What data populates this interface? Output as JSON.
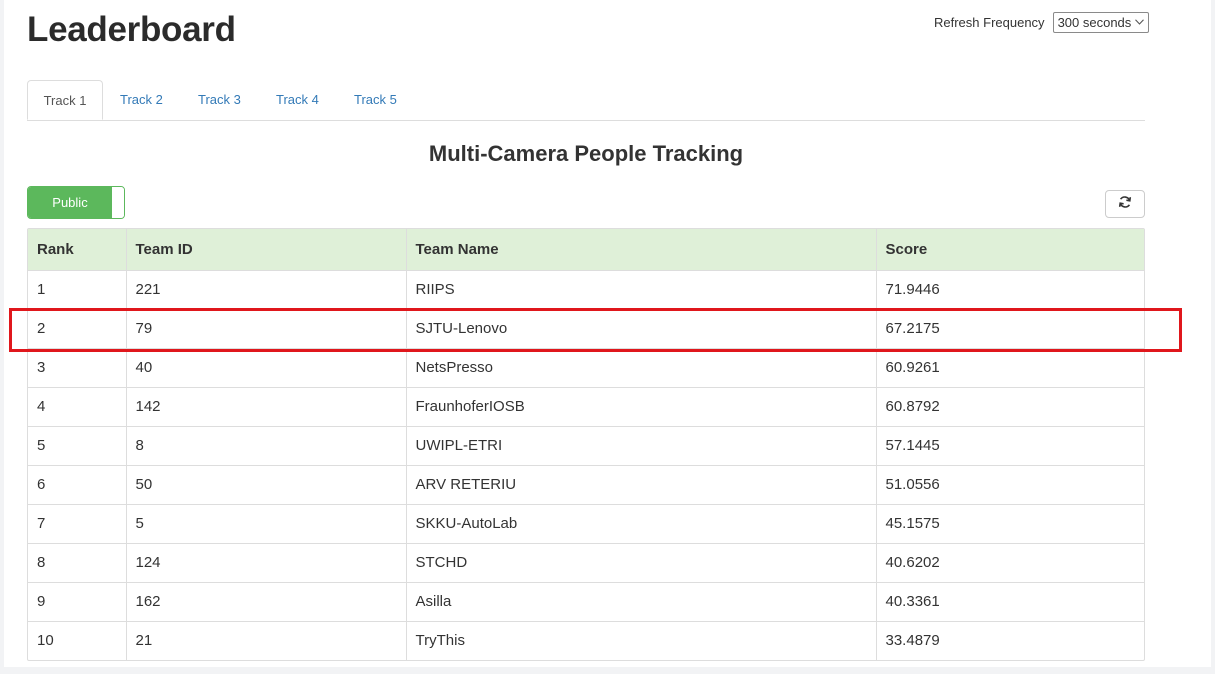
{
  "header": {
    "title": "Leaderboard",
    "refresh_label": "Refresh Frequency",
    "refresh_value": "300 seconds"
  },
  "tabs": [
    {
      "label": "Track 1",
      "active": true
    },
    {
      "label": "Track 2",
      "active": false
    },
    {
      "label": "Track 3",
      "active": false
    },
    {
      "label": "Track 4",
      "active": false
    },
    {
      "label": "Track 5",
      "active": false
    }
  ],
  "section_title": "Multi-Camera People Tracking",
  "toggle": {
    "label": "Public",
    "state": "on",
    "color": "#5cb85c"
  },
  "refresh_button": {
    "icon": "refresh-icon"
  },
  "table": {
    "columns": [
      "Rank",
      "Team ID",
      "Team Name",
      "Score"
    ],
    "rows": [
      [
        "1",
        "221",
        "RIIPS",
        "71.9446"
      ],
      [
        "2",
        "79",
        "SJTU-Lenovo",
        "67.2175"
      ],
      [
        "3",
        "40",
        "NetsPresso",
        "60.9261"
      ],
      [
        "4",
        "142",
        "FraunhoferIOSB",
        "60.8792"
      ],
      [
        "5",
        "8",
        "UWIPL-ETRI",
        "57.1445"
      ],
      [
        "6",
        "50",
        "ARV RETERIU",
        "51.0556"
      ],
      [
        "7",
        "5",
        "SKKU-AutoLab",
        "45.1575"
      ],
      [
        "8",
        "124",
        "STCHD",
        "40.6202"
      ],
      [
        "9",
        "162",
        "Asilla",
        "40.3361"
      ],
      [
        "10",
        "21",
        "TryThis",
        "33.4879"
      ]
    ],
    "header_bg": "#dff0d8"
  },
  "highlight": {
    "row_index": 1,
    "color": "#e0171c"
  }
}
